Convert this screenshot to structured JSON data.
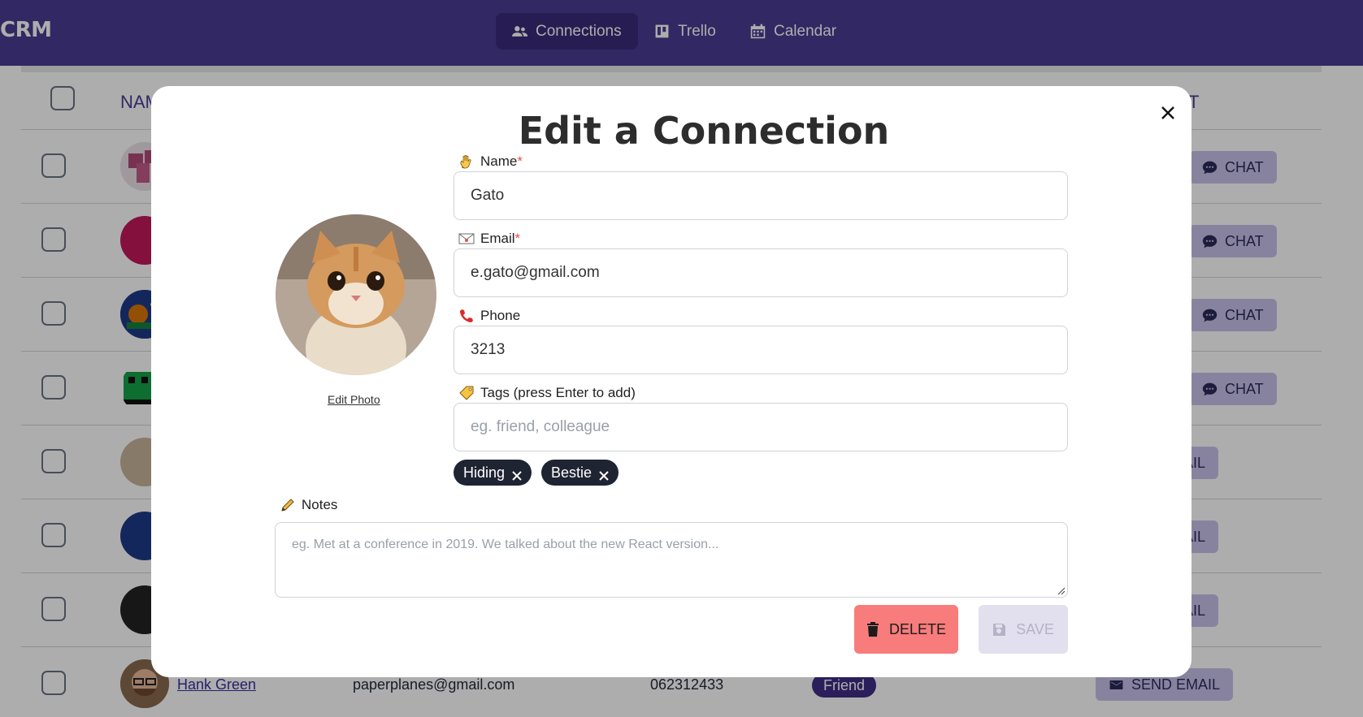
{
  "navbar": {
    "brand": "CRM",
    "items": [
      {
        "label": "Connections",
        "icon": "users-icon",
        "active": true
      },
      {
        "label": "Trello",
        "icon": "board-icon",
        "active": false
      },
      {
        "label": "Calendar",
        "icon": "calendar-icon",
        "active": false
      }
    ]
  },
  "background_table": {
    "header_name": "NAM",
    "header_right": "T",
    "rows": [
      {
        "action": "CHAT"
      },
      {
        "action": "CHAT"
      },
      {
        "action": "CHAT"
      },
      {
        "action": "CHAT"
      },
      {
        "action": "AIL"
      },
      {
        "action": "AIL"
      },
      {
        "action": "AIL"
      },
      {
        "name": "Hank Green",
        "email": "paperplanes@gmail.com",
        "phone": "062312433",
        "tag": "Friend",
        "action": "SEND EMAIL"
      }
    ]
  },
  "modal": {
    "title": "Edit a Connection",
    "edit_photo_label": "Edit Photo",
    "name": {
      "label": "Name",
      "required_mark": "*",
      "value": "Gato"
    },
    "email": {
      "label": "Email",
      "required_mark": "*",
      "value": "e.gato@gmail.com"
    },
    "phone": {
      "label": "Phone",
      "value": "3213"
    },
    "tags_field": {
      "label": "Tags (press Enter to add)",
      "placeholder": "eg. friend, colleague"
    },
    "tags": [
      "Hiding",
      "Bestie"
    ],
    "notes": {
      "label": "Notes",
      "placeholder": "eg. Met at a conference in 2019. We talked about the new React version..."
    },
    "delete_label": "DELETE",
    "save_label": "SAVE"
  },
  "colors": {
    "navbar": "#4b3b93",
    "navbar_active": "#3a2c7a",
    "delete": "#f87c7c",
    "save_disabled": "#e2e0ee",
    "tag": "#1f2433"
  }
}
